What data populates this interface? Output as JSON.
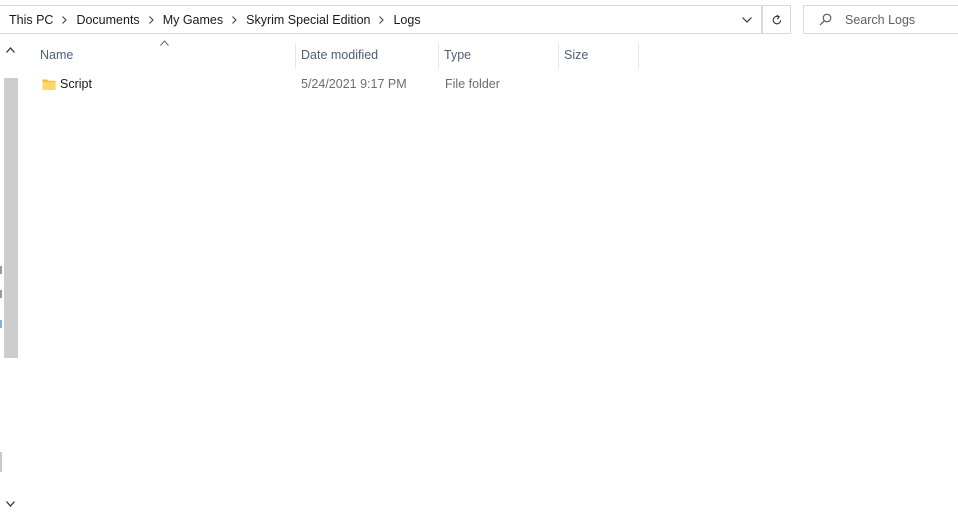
{
  "address_bar": {
    "breadcrumbs": [
      {
        "label": "This PC"
      },
      {
        "label": "Documents"
      },
      {
        "label": "My Games"
      },
      {
        "label": "Skyrim Special Edition"
      },
      {
        "label": "Logs"
      }
    ]
  },
  "search": {
    "placeholder": "Search Logs",
    "value": ""
  },
  "columns": {
    "name": "Name",
    "date_modified": "Date modified",
    "type": "Type",
    "size": "Size",
    "sorted_by": "Name",
    "sort_direction": "ascending"
  },
  "files": [
    {
      "name": "Script",
      "date_modified": "5/24/2021 9:17 PM",
      "type": "File folder",
      "size": "",
      "icon": "folder-icon"
    }
  ],
  "colors": {
    "header_text": "#4c607a",
    "secondary_text": "#6d6d6d",
    "folder_yellow": "#ffd766",
    "border": "#d9d9d9",
    "scroll_thumb": "#cdcdcd"
  }
}
